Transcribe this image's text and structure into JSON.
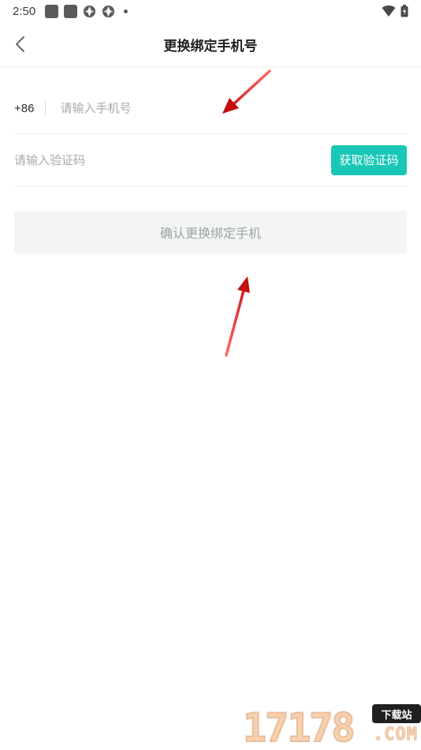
{
  "status_bar": {
    "time": "2:50"
  },
  "header": {
    "title": "更换绑定手机号"
  },
  "phone": {
    "country_code": "+86",
    "placeholder": "请输入手机号",
    "value": ""
  },
  "code": {
    "placeholder": "请输入验证码",
    "value": "",
    "get_code_label": "获取验证码"
  },
  "confirm_label": "确认更换绑定手机",
  "colors": {
    "accent": "#19c7b6",
    "arrow": "#e02020",
    "disabled_bg": "#f3f5f5",
    "disabled_text": "#9ea3a3"
  },
  "watermark": {
    "number": "17178",
    "tag": "下载站",
    "suffix": ".COM"
  }
}
